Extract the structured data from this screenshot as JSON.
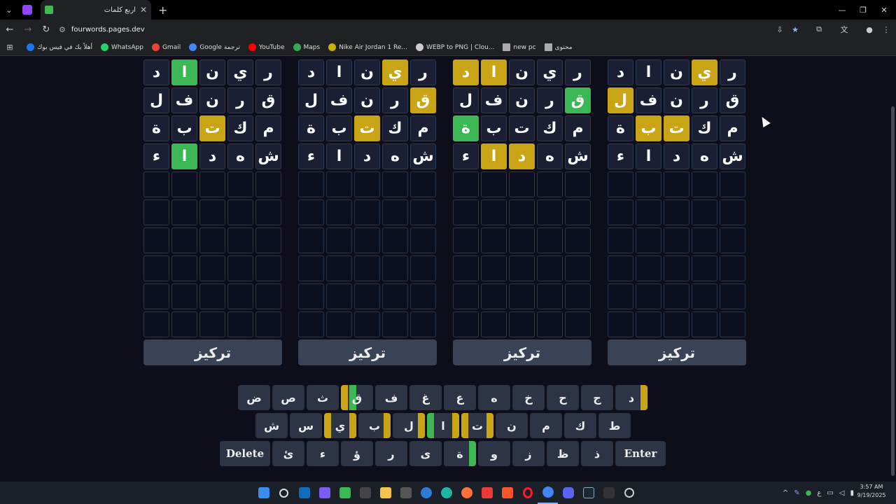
{
  "browser": {
    "tab_title": "أربع كلمات",
    "url": "fourwords.pages.dev",
    "bookmarks": [
      {
        "label": "أهلاً بك في فيس بوك",
        "color": "#1877f2"
      },
      {
        "label": "WhatsApp",
        "color": "#25d366"
      },
      {
        "label": "Gmail",
        "color": "#ea4335"
      },
      {
        "label": "Google ترجمة",
        "color": "#4285f4"
      },
      {
        "label": "YouTube",
        "color": "#ff0000"
      },
      {
        "label": "Maps",
        "color": "#34a853"
      },
      {
        "label": "Nike Air Jordan 1 Re...",
        "color": "#c8b400"
      },
      {
        "label": "WEBP to PNG | Clou...",
        "color": "#cccccc"
      },
      {
        "label": "new pc",
        "color": "#aaaaaa"
      },
      {
        "label": "محتوى",
        "color": "#aaaaaa"
      }
    ]
  },
  "boards": [
    {
      "rows": [
        [
          [
            "د",
            "n"
          ],
          [
            "ا",
            "g"
          ],
          [
            "ن",
            "n"
          ],
          [
            "ي",
            "n"
          ],
          [
            "ر",
            "n"
          ]
        ],
        [
          [
            "ل",
            "n"
          ],
          [
            "ف",
            "n"
          ],
          [
            "ن",
            "n"
          ],
          [
            "ر",
            "n"
          ],
          [
            "ق",
            "n"
          ]
        ],
        [
          [
            "ة",
            "n"
          ],
          [
            "ب",
            "n"
          ],
          [
            "ت",
            "y"
          ],
          [
            "ك",
            "n"
          ],
          [
            "م",
            "n"
          ]
        ],
        [
          [
            "ء",
            "n"
          ],
          [
            "ا",
            "g"
          ],
          [
            "د",
            "n"
          ],
          [
            "ه",
            "n"
          ],
          [
            "ش",
            "n"
          ]
        ]
      ],
      "focus_label": "تركيز"
    },
    {
      "rows": [
        [
          [
            "د",
            "n"
          ],
          [
            "ا",
            "n"
          ],
          [
            "ن",
            "n"
          ],
          [
            "ي",
            "y"
          ],
          [
            "ر",
            "n"
          ]
        ],
        [
          [
            "ل",
            "n"
          ],
          [
            "ف",
            "n"
          ],
          [
            "ن",
            "n"
          ],
          [
            "ر",
            "n"
          ],
          [
            "ق",
            "y"
          ]
        ],
        [
          [
            "ة",
            "n"
          ],
          [
            "ب",
            "n"
          ],
          [
            "ت",
            "y"
          ],
          [
            "ك",
            "n"
          ],
          [
            "م",
            "n"
          ]
        ],
        [
          [
            "ء",
            "n"
          ],
          [
            "ا",
            "n"
          ],
          [
            "د",
            "n"
          ],
          [
            "ه",
            "n"
          ],
          [
            "ش",
            "n"
          ]
        ]
      ],
      "focus_label": "تركيز"
    },
    {
      "rows": [
        [
          [
            "د",
            "y"
          ],
          [
            "ا",
            "y"
          ],
          [
            "ن",
            "n"
          ],
          [
            "ي",
            "n"
          ],
          [
            "ر",
            "n"
          ]
        ],
        [
          [
            "ل",
            "n"
          ],
          [
            "ف",
            "n"
          ],
          [
            "ن",
            "n"
          ],
          [
            "ر",
            "n"
          ],
          [
            "ق",
            "g"
          ]
        ],
        [
          [
            "ة",
            "g"
          ],
          [
            "ب",
            "n"
          ],
          [
            "ت",
            "n"
          ],
          [
            "ك",
            "n"
          ],
          [
            "م",
            "n"
          ]
        ],
        [
          [
            "ء",
            "n"
          ],
          [
            "ا",
            "y"
          ],
          [
            "د",
            "y"
          ],
          [
            "ه",
            "n"
          ],
          [
            "ش",
            "n"
          ]
        ]
      ],
      "focus_label": "تركيز"
    },
    {
      "rows": [
        [
          [
            "د",
            "n"
          ],
          [
            "ا",
            "n"
          ],
          [
            "ن",
            "n"
          ],
          [
            "ي",
            "y"
          ],
          [
            "ر",
            "n"
          ]
        ],
        [
          [
            "ل",
            "y"
          ],
          [
            "ف",
            "n"
          ],
          [
            "ن",
            "n"
          ],
          [
            "ر",
            "n"
          ],
          [
            "ق",
            "n"
          ]
        ],
        [
          [
            "ة",
            "n"
          ],
          [
            "ب",
            "y"
          ],
          [
            "ت",
            "y"
          ],
          [
            "ك",
            "n"
          ],
          [
            "م",
            "n"
          ]
        ],
        [
          [
            "ء",
            "n"
          ],
          [
            "ا",
            "n"
          ],
          [
            "د",
            "n"
          ],
          [
            "ه",
            "n"
          ],
          [
            "ش",
            "n"
          ]
        ]
      ],
      "focus_label": "تركيز"
    }
  ],
  "keyboard": {
    "row1": [
      {
        "k": "ض"
      },
      {
        "k": "ص"
      },
      {
        "k": "ث"
      },
      {
        "k": "ق",
        "marks": [
          "yellow",
          "green"
        ]
      },
      {
        "k": "ف"
      },
      {
        "k": "غ"
      },
      {
        "k": "ع"
      },
      {
        "k": "ه"
      },
      {
        "k": "خ"
      },
      {
        "k": "ح"
      },
      {
        "k": "ج"
      },
      {
        "k": "د",
        "marks": [
          "",
          "",
          "",
          "yellow"
        ]
      }
    ],
    "row2": [
      {
        "k": "ش"
      },
      {
        "k": "س"
      },
      {
        "k": "ي",
        "marks": [
          "yellow",
          "",
          "",
          "yellow"
        ]
      },
      {
        "k": "ب",
        "marks": [
          "",
          "",
          "",
          "yellow"
        ]
      },
      {
        "k": "ل",
        "marks": [
          "",
          "",
          "",
          "yellow"
        ]
      },
      {
        "k": "ا",
        "marks": [
          "green",
          "",
          "",
          "yellow"
        ]
      },
      {
        "k": "ت",
        "marks": [
          "yellow",
          "",
          "",
          "yellow"
        ]
      },
      {
        "k": "ن"
      },
      {
        "k": "م"
      },
      {
        "k": "ك"
      },
      {
        "k": "ط"
      }
    ],
    "row3": [
      {
        "k": "Delete",
        "wide": true
      },
      {
        "k": "ئ"
      },
      {
        "k": "ء"
      },
      {
        "k": "ؤ"
      },
      {
        "k": "ر"
      },
      {
        "k": "ى"
      },
      {
        "k": "ة",
        "marks": [
          "",
          "",
          "",
          "green"
        ]
      },
      {
        "k": "و"
      },
      {
        "k": "ز"
      },
      {
        "k": "ظ"
      },
      {
        "k": "ذ"
      },
      {
        "k": "Enter",
        "wide": true
      }
    ]
  },
  "taskbar": {
    "time": "3:57 AM",
    "date": "9/19/2025",
    "lang": "ع"
  }
}
